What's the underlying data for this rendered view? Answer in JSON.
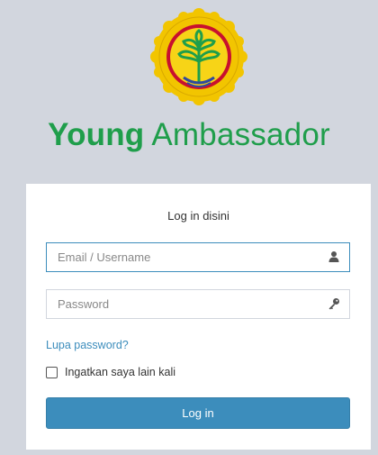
{
  "brand": {
    "bold": "Young",
    "light": "Ambassador",
    "color": "#1f9e4b"
  },
  "logo": {
    "icon": "ministry-emblem-icon",
    "colors": {
      "outer": "#f2c500",
      "ring_red": "#c8102e",
      "inner": "#f7d417",
      "leaves": "#1f9e4b",
      "base": "#2e4a9e"
    }
  },
  "login": {
    "title": "Log in disini",
    "email_placeholder": "Email / Username",
    "email_value": "",
    "email_icon": "user-icon",
    "password_placeholder": "Password",
    "password_value": "",
    "password_icon": "key-icon",
    "forgot_label": "Lupa password?",
    "remember_label": "Ingatkan saya lain kali",
    "remember_checked": false,
    "submit_label": "Log in",
    "accent": "#3c8dbc"
  }
}
